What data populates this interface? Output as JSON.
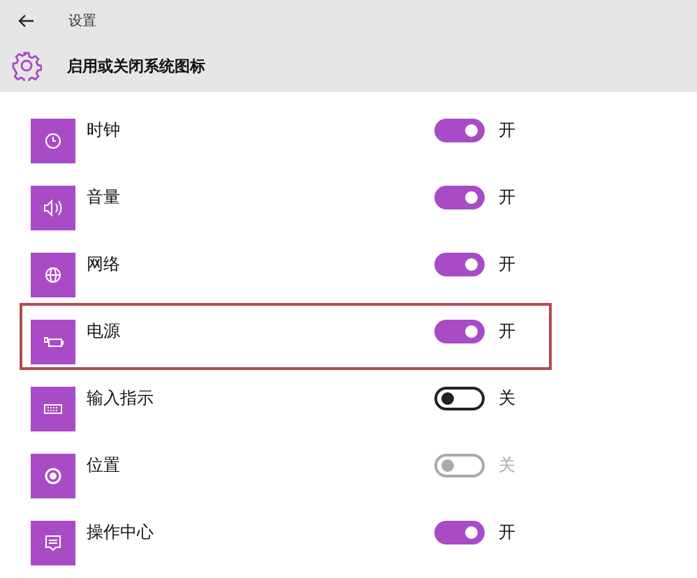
{
  "window": {
    "title": "设置"
  },
  "page": {
    "title": "启用或关闭系统图标"
  },
  "items": [
    {
      "name": "时钟",
      "on": true,
      "disabled": false,
      "highlighted": false,
      "state_text": "开"
    },
    {
      "name": "音量",
      "on": true,
      "disabled": false,
      "highlighted": false,
      "state_text": "开"
    },
    {
      "name": "网络",
      "on": true,
      "disabled": false,
      "highlighted": false,
      "state_text": "开"
    },
    {
      "name": "电源",
      "on": true,
      "disabled": false,
      "highlighted": true,
      "state_text": "开"
    },
    {
      "name": "输入指示",
      "on": false,
      "disabled": false,
      "highlighted": false,
      "state_text": "关"
    },
    {
      "name": "位置",
      "on": false,
      "disabled": true,
      "highlighted": false,
      "state_text": "关"
    },
    {
      "name": "操作中心",
      "on": true,
      "disabled": false,
      "highlighted": false,
      "state_text": "开"
    }
  ]
}
